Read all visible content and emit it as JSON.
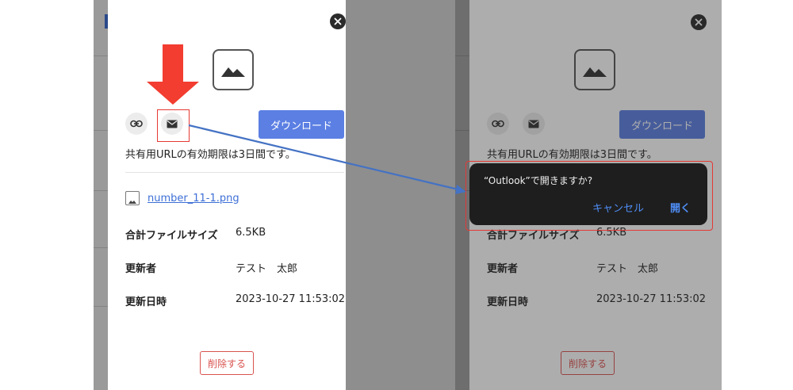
{
  "dialog_actions": {
    "open_in": "“Outlook”で開きますか?",
    "cancel": "キャンセル",
    "open": "開く"
  },
  "share_panel": {
    "download_label": "ダウンロード",
    "expiry_note": "共有用URLの有効期限は3日間です。",
    "file_name": "number_11-1.png",
    "details": [
      {
        "label": "合計ファイルサイズ",
        "value": "6.5KB"
      },
      {
        "label": "更新者",
        "value": "テスト　太郎"
      },
      {
        "label": "更新日時",
        "value": "2023-10-27 11:53:02"
      }
    ],
    "delete_label": "削除する"
  },
  "icons": {
    "close": "close-icon",
    "image": "image-icon",
    "link": "link-icon",
    "mail": "mail-icon"
  },
  "colors": {
    "download_button": "#5b7fe3",
    "delete_button": "#d9534f",
    "link_text": "#3d6fd6",
    "annotation_red": "#e53935",
    "annotation_arrow": "#4472c4",
    "dialog_background": "#1e1e1e"
  }
}
